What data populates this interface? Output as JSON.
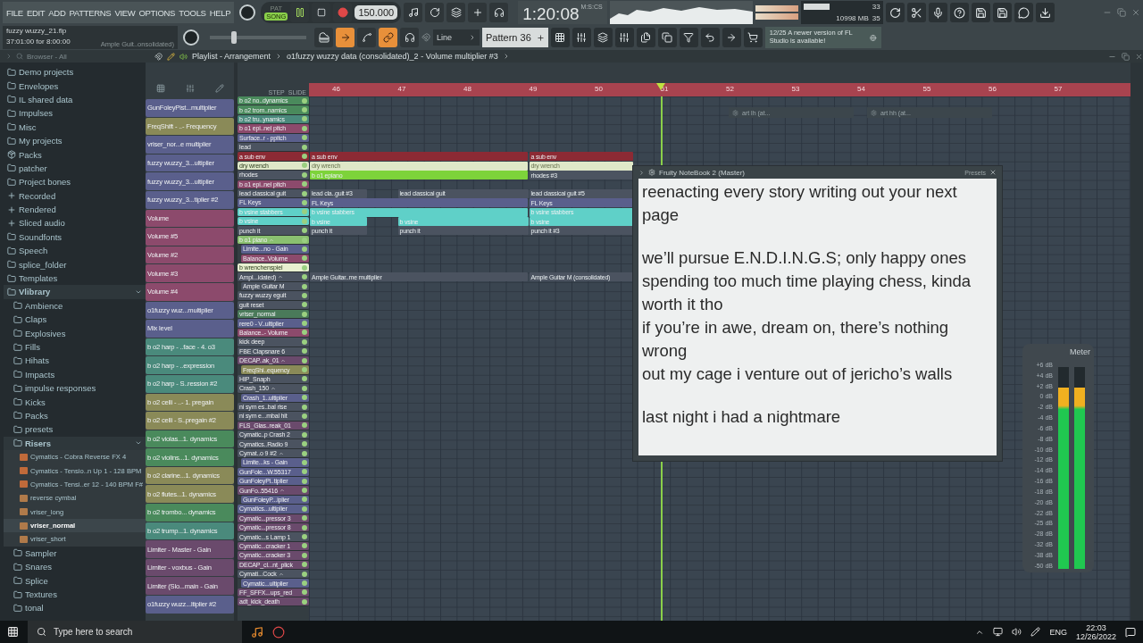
{
  "menu": [
    "FILE",
    "EDIT",
    "ADD",
    "PATTERNS",
    "VIEW",
    "OPTIONS",
    "TOOLS",
    "HELP"
  ],
  "hint": {
    "file": "fuzzy wuzzy_21.flp",
    "time": "37:01:00 for 8:00:00",
    "target": "Ample Guit..onsolidated)"
  },
  "transport": {
    "modes": [
      {
        "label": "PAT",
        "selected": false
      },
      {
        "label": "SONG",
        "selected": true
      }
    ],
    "playing": true,
    "tempo": "150.000"
  },
  "clock": {
    "value": "1:20:08",
    "unit": "M:S:CS"
  },
  "performance": {
    "cpu": "33",
    "memory": "10998 MB",
    "polyphony": "35"
  },
  "snap": "Line",
  "pattern": "Pattern 36",
  "news": {
    "date": "12/25",
    "text": "A newer version of FL Studio is available!"
  },
  "browser": {
    "title": "Browser - All",
    "items": [
      {
        "label": "Demo projects",
        "kind": "folder"
      },
      {
        "label": "Envelopes",
        "kind": "folder"
      },
      {
        "label": "IL shared data",
        "kind": "folder"
      },
      {
        "label": "Impulses",
        "kind": "folder"
      },
      {
        "label": "Misc",
        "kind": "folder"
      },
      {
        "label": "My projects",
        "kind": "folder"
      },
      {
        "label": "Packs",
        "kind": "packs"
      },
      {
        "label": "patcher",
        "kind": "folder"
      },
      {
        "label": "Project bones",
        "kind": "folder"
      },
      {
        "label": "Recorded",
        "kind": "special"
      },
      {
        "label": "Rendered",
        "kind": "special"
      },
      {
        "label": "Sliced audio",
        "kind": "special"
      },
      {
        "label": "Soundfonts",
        "kind": "folder"
      },
      {
        "label": "Speech",
        "kind": "folder"
      },
      {
        "label": "splice_folder",
        "kind": "folder"
      },
      {
        "label": "Templates",
        "kind": "folder"
      },
      {
        "label": "Vlibrary",
        "kind": "folder",
        "expanded": true,
        "children": [
          {
            "label": "Ambience",
            "kind": "folder"
          },
          {
            "label": "Claps",
            "kind": "folder"
          },
          {
            "label": "Explosives",
            "kind": "folder"
          },
          {
            "label": "Fills",
            "kind": "folder"
          },
          {
            "label": "Hihats",
            "kind": "folder"
          },
          {
            "label": "Impacts",
            "kind": "folder"
          },
          {
            "label": "impulse responses",
            "kind": "folder"
          },
          {
            "label": "Kicks",
            "kind": "folder"
          },
          {
            "label": "Packs",
            "kind": "folder"
          },
          {
            "label": "presets",
            "kind": "folder"
          },
          {
            "label": "Risers",
            "kind": "folder",
            "expanded": true,
            "children": [
              {
                "label": "Cymatics - Cobra Reverse FX 4",
                "kind": "wav",
                "selected": false
              },
              {
                "label": "Cymatics - Tensio..n Up 1 - 128 BPM",
                "kind": "wav",
                "selected": false
              },
              {
                "label": "Cymatics - Tensi..er 12 - 140 BPM F#",
                "kind": "wav",
                "selected": false
              },
              {
                "label": "reverse cymbal",
                "kind": "mp3",
                "selected": false
              },
              {
                "label": "vriser_long",
                "kind": "mp3",
                "selected": false
              },
              {
                "label": "vriser_normal",
                "kind": "mp3",
                "selected": true
              },
              {
                "label": "vriser_short",
                "kind": "mp3",
                "selected": false
              }
            ]
          },
          {
            "label": "Sampler",
            "kind": "folder"
          },
          {
            "label": "Snares",
            "kind": "folder"
          },
          {
            "label": "Splice",
            "kind": "folder"
          },
          {
            "label": "Textures",
            "kind": "folder"
          },
          {
            "label": "tonal",
            "kind": "folder"
          }
        ]
      }
    ]
  },
  "playlist": {
    "path": [
      "Playlist - Arrangement",
      "o1fuzzy wuzzy data (consolidated)_2 - Volume multiplier #3"
    ],
    "column_labels": [
      "STEP",
      "SLIDE"
    ],
    "ruler": [
      "46",
      "47",
      "48",
      "49",
      "50",
      "51",
      "52",
      "53",
      "54",
      "55",
      "56",
      "57"
    ],
    "floating": [
      "art lh (at...",
      "art hh (at..."
    ],
    "patterns": [
      {
        "label": "GunFoleyPist...multiplier",
        "color": "#5a5f8c"
      },
      {
        "label": "FreqShift - ..- Frequency",
        "color": "#8a8a58"
      },
      {
        "label": "vriser_nor...e multiplier",
        "color": "#5a5f8c"
      },
      {
        "label": "fuzzy wuzzy_3...ultiplier",
        "color": "#5a5f8c"
      },
      {
        "label": "fuzzy wuzzy_3...ultiplier",
        "color": "#5a5f8c"
      },
      {
        "label": "fuzzy wuzzy_3...tiplier #2",
        "color": "#5a5f8c"
      },
      {
        "label": "Volume",
        "color": "#8c4a6c"
      },
      {
        "label": "Volume #5",
        "color": "#8c4a6c"
      },
      {
        "label": "Volume #2",
        "color": "#8c4a6c"
      },
      {
        "label": "Volume #3",
        "color": "#8c4a6c"
      },
      {
        "label": "Volume #4",
        "color": "#8c4a6c"
      },
      {
        "label": "o1fuzzy wuz...multiplier",
        "color": "#5a5f8c"
      },
      {
        "label": "Mix level",
        "color": "#5a5f8c"
      },
      {
        "label": "b o2 harp - ..face - 4. o3",
        "color": "#4a8a7c"
      },
      {
        "label": "b o2 harp - ..expression",
        "color": "#4a8a7c"
      },
      {
        "label": "b o2 harp - S..ression #2",
        "color": "#4a8a7c"
      },
      {
        "label": "b o2 celli - ..- 1. pregain",
        "color": "#8a8a58"
      },
      {
        "label": "b o2 celli - S..pregain #2",
        "color": "#8a8a58"
      },
      {
        "label": "b o2 violas...1. dynamics",
        "color": "#4a8a5c"
      },
      {
        "label": "b o2 violins...1. dynamics",
        "color": "#4a8a5c"
      },
      {
        "label": "b o2 clarine...1. dynamics",
        "color": "#8a8a58"
      },
      {
        "label": "b o2 flutes...1. dynamics",
        "color": "#8a8a58"
      },
      {
        "label": "b o2 trombo... dynamics",
        "color": "#4a8a5c"
      },
      {
        "label": "b o2 trump...1. dynamics",
        "color": "#4a8a7c"
      },
      {
        "label": "Limiter - Master - Gain",
        "color": "#6a4a6c"
      },
      {
        "label": "Limiter - voxbus - Gain",
        "color": "#6a4a6c"
      },
      {
        "label": "Limiter (Slo...main - Gain",
        "color": "#6a4a6c"
      },
      {
        "label": "o1fuzzy wuzz...ltiplier #2",
        "color": "#5a5f8c"
      }
    ],
    "tracks": [
      {
        "label": "b o2 no..dynamics",
        "color": "#4a8a5c"
      },
      {
        "label": "b o2 trom..namics",
        "color": "#4a8a5c"
      },
      {
        "label": "b o2 tru..ynamics",
        "color": "#4a8a7c"
      },
      {
        "label": "b o1 epi..nel pitch",
        "color": "#8c4a6c"
      },
      {
        "label": "Surface..r - ppitch",
        "color": "#5a5f8c"
      },
      {
        "label": "lead",
        "color": "#4b5360"
      },
      {
        "label": "a sub env",
        "color": "#8c2a34",
        "clips": [
          {
            "label": "a sub env",
            "color": "#8c2a34"
          },
          {
            "label": "a sub env",
            "color": "#8c2a34"
          }
        ]
      },
      {
        "label": "dry wrench",
        "color": "#dfe8c8",
        "clips": [
          {
            "label": "dry wrench",
            "color": "#dfe8c8"
          },
          {
            "label": "dry wrench",
            "color": "#dfe8c8"
          }
        ]
      },
      {
        "label": "rhodes",
        "color": "#4b5360",
        "clips": [
          {
            "label": "b o1 epiano",
            "color": "#7dd33a"
          },
          {
            "label": "rhodes #3",
            "color": "#4b5360"
          }
        ]
      },
      {
        "label": "b o1 epi..nel pitch",
        "color": "#8c4a6c"
      },
      {
        "label": "lead classical guit",
        "color": "#4b5360",
        "clips": [
          {
            "label": "lead cla..guit #3",
            "color": "#4b5360"
          },
          {
            "label": "lead classical guit",
            "color": "#4b5360"
          },
          {
            "label": "lead classical guit #5",
            "color": "#4b5360"
          }
        ]
      },
      {
        "label": "FL Keys",
        "color": "#5a5f8c",
        "clips": [
          {
            "label": "FL Keys",
            "color": "#5a5f8c"
          },
          {
            "label": "FL Keys",
            "color": "#5a5f8c"
          }
        ]
      },
      {
        "label": "b vsine stabbers",
        "color": "#5fd0c8",
        "clips": [
          {
            "label": "b vsine stabbers",
            "color": "#5fd0c8"
          },
          {
            "label": "b vsine stabbers",
            "color": "#5fd0c8"
          }
        ]
      },
      {
        "label": "b vsine",
        "color": "#5fd0c8",
        "clips": [
          {
            "label": "b vsine",
            "color": "#5fd0c8"
          },
          {
            "label": "b vsine",
            "color": "#5fd0c8"
          },
          {
            "label": "b vsine",
            "color": "#5fd0c8"
          }
        ]
      },
      {
        "label": "punch it",
        "color": "#4b5360",
        "clips": [
          {
            "label": "punch it",
            "color": "#4b5360"
          },
          {
            "label": "punch it",
            "color": "#4b5360"
          },
          {
            "label": "punch it #3",
            "color": "#4b5360"
          }
        ]
      },
      {
        "label": "b o1 piano",
        "color": "#8ac070",
        "expanded": true,
        "children": [
          {
            "label": "Limite...no - Gain",
            "color": "#5a5f8c"
          },
          {
            "label": "Balance..Volume",
            "color": "#8c4a6c"
          }
        ]
      },
      {
        "label": "b wrenchenspiel",
        "color": "#e8f0d0"
      },
      {
        "label": "Ampl...idated)",
        "color": "#4b5360",
        "expanded": true,
        "clips": [
          {
            "label": "Ample Guitar..me multiplier",
            "color": "#4b5360"
          },
          {
            "label": "Ample Guitar M (consolidated)",
            "color": "#4b5360"
          }
        ],
        "children": [
          {
            "label": "Ample Guitar M",
            "color": "#4b5360"
          }
        ]
      },
      {
        "label": "fuzzy wuzzy eguit",
        "color": "#4b5360"
      },
      {
        "label": "guit reset",
        "color": "#4b5360"
      },
      {
        "label": "vriser_normal",
        "color": "#4a7a5a"
      },
      {
        "label": "rere0 - V..ultiplier",
        "color": "#5a5f8c"
      },
      {
        "label": "Balance..- Volume",
        "color": "#8c4a6c"
      },
      {
        "label": "kick deep",
        "color": "#4b5360"
      },
      {
        "label": "FBE Clapsnare 6",
        "color": "#4b5360"
      },
      {
        "label": "DECAP..ak_01",
        "color": "#6a4a6c",
        "expanded": true,
        "children": [
          {
            "label": "FreqShi..equency",
            "color": "#8a8a58"
          }
        ]
      },
      {
        "label": "HIP_Snaph",
        "color": "#4b5360"
      },
      {
        "label": "Crash_150",
        "color": "#4b5360",
        "expanded": true,
        "children": [
          {
            "label": "Crash_1..ultiplier",
            "color": "#5a5f8c"
          }
        ]
      },
      {
        "label": "ni sym es..bal rise",
        "color": "#4b5360"
      },
      {
        "label": "ni sym e...mbal hit",
        "color": "#4b5360"
      },
      {
        "label": "FLS_Glas..reak_01",
        "color": "#6a4a6c"
      },
      {
        "label": "Cymatic..p Crash 2",
        "color": "#4b5360"
      },
      {
        "label": "Cymatics..Radio 9",
        "color": "#4b5360"
      },
      {
        "label": "Cymat..o 9 #2",
        "color": "#4b5360",
        "expanded": true,
        "children": [
          {
            "label": "Limite...ks - Gain",
            "color": "#5a5f8c"
          }
        ]
      },
      {
        "label": "GunFole...W.55317",
        "color": "#5a5f8c"
      },
      {
        "label": "GunFoleyPi..tiplier",
        "color": "#5a5f8c"
      },
      {
        "label": "GunFo..55416",
        "color": "#6a4a6c",
        "expanded": true,
        "children": [
          {
            "label": "GunFoleyP...iplier",
            "color": "#5a5f8c"
          }
        ]
      },
      {
        "label": "Cymatics...ultiplier",
        "color": "#5a5f8c"
      },
      {
        "label": "Cymatic...pressor 3",
        "color": "#6a4a6c"
      },
      {
        "label": "Cymatic...pressor 8",
        "color": "#6a4a6c"
      },
      {
        "label": "Cymatic...s Lamp 1",
        "color": "#4b5360"
      },
      {
        "label": "Cymatic...cracker 1",
        "color": "#6a4a6c"
      },
      {
        "label": "Cymatic...cracker 3",
        "color": "#6a4a6c"
      },
      {
        "label": "DECAP_cl...nt_plick",
        "color": "#6a4a6c"
      },
      {
        "label": "Cymati...Cock",
        "color": "#4b5360",
        "expanded": true,
        "children": [
          {
            "label": "Cymatic...ultiplier",
            "color": "#5a5f8c"
          }
        ]
      },
      {
        "label": "FF_SFFX...ups_red",
        "color": "#6a4a6c"
      },
      {
        "label": "adt_kick_death",
        "color": "#6a4a6c"
      }
    ]
  },
  "notebook": {
    "title": "Fruity NoteBook 2 (Master)",
    "presets": "Presets",
    "paragraphs": [
      [
        "reenacting every story writing out your next page"
      ],
      [
        "we’ll pursue E.N.D.I.N.G.S; only happy ones",
        "spending too much time playing chess, kinda worth it tho",
        "if you’re in awe, dream on, there’s nothing wrong",
        "out my cage i venture out of jericho’s walls"
      ],
      [
        "last night i had a nightmare"
      ]
    ]
  },
  "meter": {
    "title": "Meter",
    "scale": [
      "+6 dB",
      "+4 dB",
      "+2 dB",
      "0 dB",
      "-2 dB",
      "-4 dB",
      "-6 dB",
      "-8 dB",
      "-10 dB",
      "-12 dB",
      "-14 dB",
      "-16 dB",
      "-18 dB",
      "-20 dB",
      "-22 dB",
      "-25 dB",
      "-28 dB",
      "-32 dB",
      "-38 dB",
      "-50 dB"
    ],
    "channels": [
      {
        "level": 0.9
      },
      {
        "level": 0.9
      }
    ]
  },
  "taskbar": {
    "search": "Type here to search",
    "language": "ENG",
    "time": "22:03",
    "date": "12/26/2022"
  }
}
